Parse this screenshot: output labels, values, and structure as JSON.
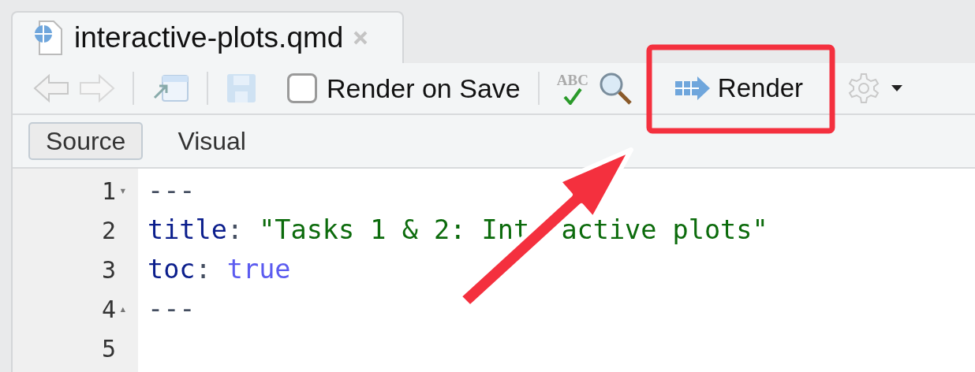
{
  "file_tab": {
    "title": "interactive-plots.qmd",
    "closable": true
  },
  "toolbar": {
    "render_on_save": {
      "label": "Render on Save",
      "checked": false
    },
    "spellcheck_label": "ABC",
    "render_button": {
      "label": "Render"
    }
  },
  "editor_tabs": [
    {
      "label": "Source",
      "selected": true
    },
    {
      "label": "Visual",
      "selected": false
    }
  ],
  "lines": [
    {
      "number": "1",
      "fold": "▾",
      "tokens": [
        {
          "kind": "punct",
          "text": "---"
        }
      ]
    },
    {
      "number": "2",
      "tokens": [
        {
          "kind": "key",
          "text": "title"
        },
        {
          "kind": "punct",
          "text": ": "
        },
        {
          "kind": "string",
          "text": "\"Tasks 1 & 2: Int"
        },
        {
          "kind": "hidden-string",
          "text": "active plots\""
        }
      ]
    },
    {
      "number": "3",
      "tokens": [
        {
          "kind": "key",
          "text": "toc"
        },
        {
          "kind": "punct",
          "text": ": "
        },
        {
          "kind": "bool",
          "text": "true"
        }
      ]
    },
    {
      "number": "4",
      "fold": "▴",
      "tokens": [
        {
          "kind": "punct",
          "text": "---"
        }
      ]
    },
    {
      "number": "5"
    }
  ]
}
